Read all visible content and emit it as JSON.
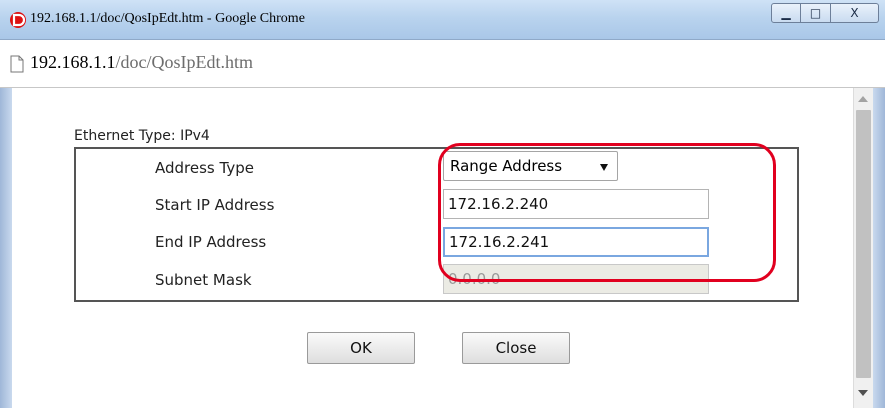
{
  "window": {
    "title": "192.168.1.1/doc/QosIpEdt.htm - Google Chrome",
    "min_glyph": "▁",
    "max_glyph": "□",
    "close_glyph": "X"
  },
  "address_bar": {
    "host": "192.168.1.1",
    "path": "/doc/QosIpEdt.htm",
    "icon": "page-icon"
  },
  "form": {
    "ethernet_type_label": "Ethernet Type: IPv4",
    "address_type": {
      "label": "Address Type",
      "selected": "Range Address"
    },
    "start_ip": {
      "label": "Start IP Address",
      "value": "172.16.2.240"
    },
    "end_ip": {
      "label": "End IP Address",
      "value": "172.16.2.241"
    },
    "subnet_mask": {
      "label": "Subnet Mask",
      "value": "0.0.0.0"
    }
  },
  "buttons": {
    "ok": "OK",
    "close": "Close"
  },
  "colors": {
    "highlight": "#e1001f",
    "focus_border": "#7aa7e0",
    "titlebar": "#b9d3ee"
  }
}
